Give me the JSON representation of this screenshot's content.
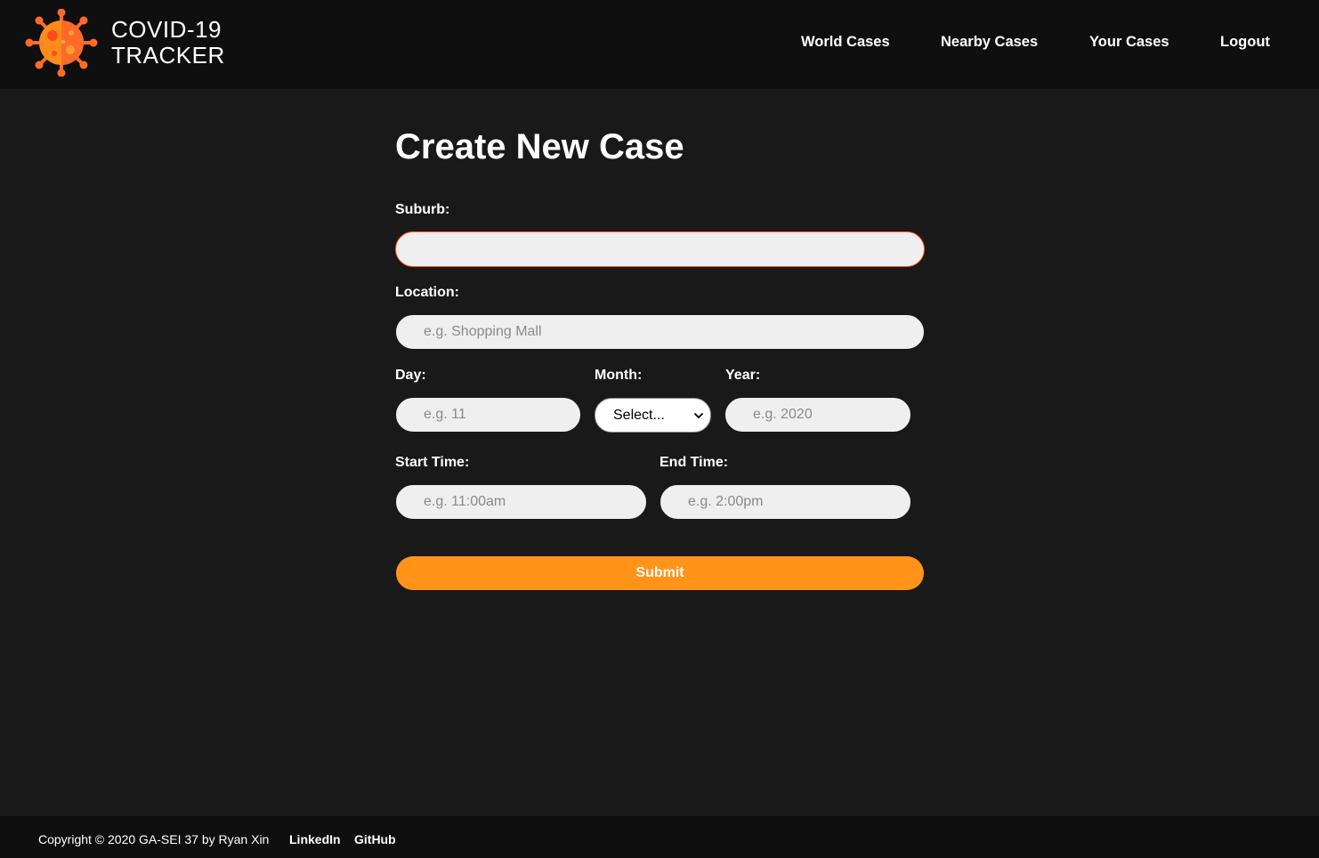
{
  "header": {
    "brand_line1": "COVID-19",
    "brand_line2": "TRACKER",
    "nav": {
      "world": "World Cases",
      "nearby": "Nearby Cases",
      "yours": "Your Cases",
      "logout": "Logout"
    }
  },
  "form": {
    "title": "Create New Case",
    "suburb": {
      "label": "Suburb:",
      "value": "",
      "placeholder": ""
    },
    "location": {
      "label": "Location:",
      "value": "",
      "placeholder": "e.g. Shopping Mall"
    },
    "day": {
      "label": "Day:",
      "value": "",
      "placeholder": "e.g. 11"
    },
    "month": {
      "label": "Month:",
      "selected": "Select..."
    },
    "year": {
      "label": "Year:",
      "value": "",
      "placeholder": "e.g. 2020"
    },
    "start_time": {
      "label": "Start Time:",
      "value": "",
      "placeholder": "e.g. 11:00am"
    },
    "end_time": {
      "label": "End Time:",
      "value": "",
      "placeholder": "e.g. 2:00pm"
    },
    "submit_label": "Submit"
  },
  "footer": {
    "copyright": "Copyright © 2020 GA-SEI 37 by Ryan Xin",
    "linkedin": "LinkedIn",
    "github": "GitHub"
  },
  "colors": {
    "background": "#191919",
    "header_bg": "#0f0f0f",
    "accent_orange": "#ff9419",
    "focus_border": "#ff5a1f",
    "input_bg": "#efefef"
  },
  "icons": {
    "logo": "virus-icon",
    "select": "chevron-down-icon"
  }
}
